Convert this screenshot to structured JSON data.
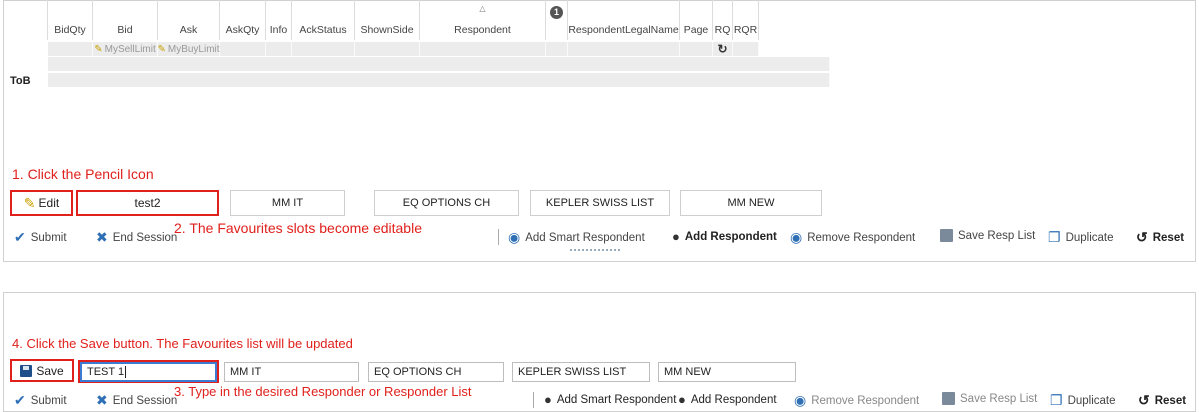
{
  "top": {
    "grid": {
      "columns": [
        {
          "label": "",
          "w": 38
        },
        {
          "label": "BidQty",
          "w": 45
        },
        {
          "label": "Bid",
          "w": 65
        },
        {
          "label": "Ask",
          "w": 62
        },
        {
          "label": "AskQty",
          "w": 46
        },
        {
          "label": "Info",
          "w": 26
        },
        {
          "label": "AckStatus",
          "w": 63
        },
        {
          "label": "ShownSide",
          "w": 65
        },
        {
          "label": "Respondent",
          "w": 126
        },
        {
          "label": "",
          "w": 22
        },
        {
          "label": "RespondentLegalName",
          "w": 112
        },
        {
          "label": "Page",
          "w": 33
        },
        {
          "label": "RQ",
          "w": 20
        },
        {
          "label": "RQR",
          "w": 26
        }
      ],
      "respondent_sort_icon": "sort-ascending-icon",
      "badge_value": "1",
      "bid_placeholder": "MySellLimit",
      "ask_placeholder": "MyBuyLimit",
      "refresh_icon": "refresh-icon",
      "row_label": "ToB"
    },
    "annotation_1": "1. Click the Pencil Icon",
    "annotation_2": "2. The Favourites slots become editable",
    "edit_button": "Edit",
    "slots": [
      "test2",
      "MM IT",
      "EQ OPTIONS CH",
      "KEPLER SWISS LIST",
      "MM NEW"
    ],
    "toolbar": {
      "submit": "Submit",
      "end_session": "End Session",
      "add_smart_respondent": "Add Smart Respondent",
      "add_respondent": "Add Respondent",
      "remove_respondent": "Remove Respondent",
      "save_resp_list": "Save Resp List",
      "duplicate": "Duplicate",
      "reset": "Reset"
    }
  },
  "bottom": {
    "annotation_4": "4. Click the Save button. The Favourites list will be updated",
    "annotation_3": "3. Type in the desired Responder or Responder List",
    "save_button": "Save",
    "inputs": [
      "TEST 1",
      "MM IT",
      "EQ OPTIONS CH",
      "KEPLER SWISS LIST",
      "MM NEW"
    ],
    "toolbar": {
      "submit": "Submit",
      "end_session": "End Session",
      "add_smart_respondent": "Add Smart Respondent",
      "add_respondent": "Add Respondent",
      "remove_respondent": "Remove Respondent",
      "save_resp_list": "Save Resp List",
      "duplicate": "Duplicate",
      "reset": "Reset"
    }
  },
  "colors": {
    "annotation_red": "#e0201c",
    "icon_blue": "#2f6fb5",
    "grid_row_grey": "#ececec"
  }
}
